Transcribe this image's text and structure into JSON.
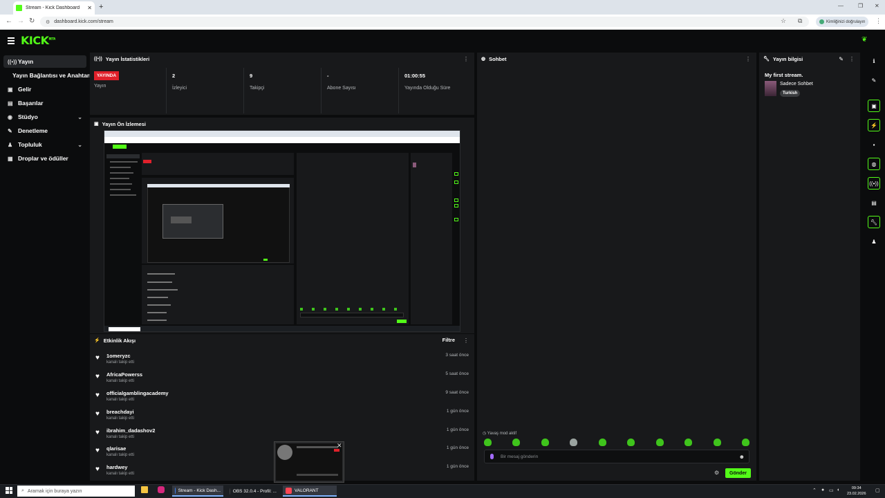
{
  "browser": {
    "tab_title": "Stream - Kick Dashboard",
    "url": "dashboard.kick.com/stream",
    "profile_label": "Kimliğinizi doğrulayın"
  },
  "brand": {
    "logo": "KICK",
    "logo_tm": "BETA",
    "accent": "#53fc18"
  },
  "sidebar": {
    "items": [
      {
        "label": "Yayın",
        "icon": "broadcast-icon"
      },
      {
        "label": "Yayın Bağlantısı ve Anahtarı",
        "icon": "none"
      },
      {
        "label": "Gelir",
        "icon": "revenue-icon"
      },
      {
        "label": "Başarılar",
        "icon": "achievements-icon"
      },
      {
        "label": "Stüdyo",
        "icon": "studio-icon"
      },
      {
        "label": "Denetleme",
        "icon": "moderation-icon"
      },
      {
        "label": "Topluluk",
        "icon": "community-icon"
      },
      {
        "label": "Droplar ve ödüller",
        "icon": "drops-icon"
      }
    ]
  },
  "stats": {
    "title": "Yayın İstatistikleri",
    "live_badge": "YAYINDA",
    "live_label": "Yayın",
    "items": [
      {
        "value": "2",
        "label": "İzleyici"
      },
      {
        "value": "9",
        "label": "Takipçi"
      },
      {
        "value": "-",
        "label": "Abone Sayısı"
      },
      {
        "value": "01:00:55",
        "label": "Yayında Olduğu Süre"
      }
    ]
  },
  "preview": {
    "title": "Yayın Ön İzlemesi"
  },
  "activity": {
    "title": "Etkinlik Akışı",
    "filter_label": "Filtre",
    "events": [
      {
        "user": "1omeryzc",
        "action": "kanalı takip etti",
        "time": "3 saat önce"
      },
      {
        "user": "AfricaPowerss",
        "action": "kanalı takip etti",
        "time": "5 saat önce"
      },
      {
        "user": "officialgamblingacademy",
        "action": "kanalı takip etti",
        "time": "9 saat önce"
      },
      {
        "user": "breachdayi",
        "action": "kanalı takip etti",
        "time": "1 gün önce"
      },
      {
        "user": "ibrahim_dadashov2",
        "action": "kanalı takip etti",
        "time": "1 gün önce"
      },
      {
        "user": "qlarisae",
        "action": "kanalı takip etti",
        "time": "1 gün önce"
      },
      {
        "user": "hardwey",
        "action": "kanalı takip etti",
        "time": "1 gün önce"
      }
    ]
  },
  "chat": {
    "title": "Sohbet",
    "slow_mode": "Yavaş mod aktif",
    "placeholder": "Bir mesaj gönderin",
    "send_label": "Gönder"
  },
  "stream_info": {
    "title": "Yayın bilgisi",
    "stream_title": "My first stream.",
    "category": "Sadece Sohbet",
    "language": "Turkish"
  },
  "taskbar": {
    "search_placeholder": "Aramak için buraya yazın",
    "apps": [
      {
        "label": "Stream - Kick Dash...",
        "color": "#3d83f6"
      },
      {
        "label": "OBS 32.0.4 - Profil: ...",
        "color": "#444"
      },
      {
        "label": "VALORANT",
        "color": "#ff4655"
      }
    ],
    "time": "09:34",
    "date": "23.02.2026"
  }
}
